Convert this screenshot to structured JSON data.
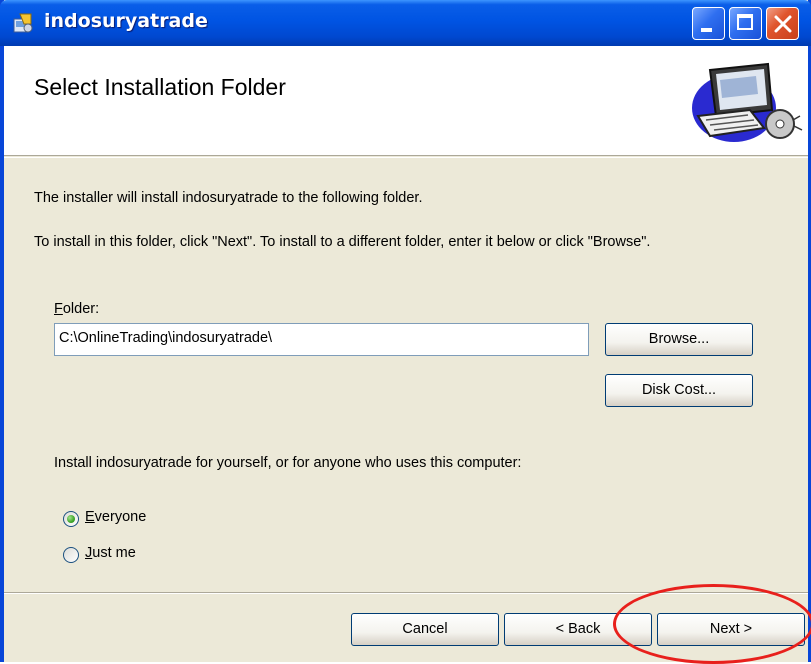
{
  "window": {
    "title": "indosuryatrade",
    "controls": {
      "minimize": "minimize",
      "maximize": "maximize",
      "close": "close"
    }
  },
  "banner": {
    "title": "Select Installation Folder",
    "art_icon": "computer-installer-graphic"
  },
  "content": {
    "intro": "The installer will install indosuryatrade to the following folder.",
    "instructions": "To install in this folder, click \"Next\". To install to a different folder, enter it below or click \"Browse\".",
    "folder_label_rest": "older:",
    "folder_label_access": "F",
    "folder_value": "C:\\OnlineTrading\\indosuryatrade\\",
    "browse_button": "Browse...",
    "disk_cost_button": "Disk Cost...",
    "scope_prompt": "Install indosuryatrade for yourself, or for anyone who uses this computer:",
    "options": [
      {
        "label_access": "E",
        "label_rest": "veryone",
        "checked": true
      },
      {
        "label_access": "J",
        "label_rest": "ust me",
        "checked": false
      }
    ]
  },
  "footer": {
    "cancel": "Cancel",
    "back": "< Back",
    "next": "Next >",
    "highlight_color": "#e8201c"
  },
  "colors": {
    "titlebar": "#0054e3",
    "dialog_bg": "#ece9d8",
    "close_button": "#e0552d"
  }
}
